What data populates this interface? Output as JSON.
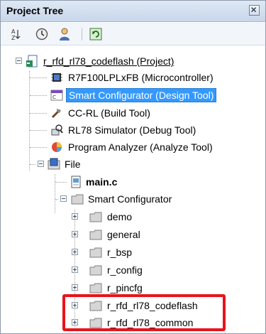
{
  "panel": {
    "title": "Project Tree"
  },
  "toolbar": {
    "buttons": [
      {
        "icon": "sort-az-icon"
      },
      {
        "icon": "clock-icon"
      },
      {
        "icon": "user-icon"
      },
      {
        "icon": "refresh-icon"
      }
    ]
  },
  "tree": {
    "project": "r_rfd_rl78_codeflash (Project)",
    "items": [
      {
        "label": "R7F100LPLxFB (Microcontroller)",
        "icon": "microcontroller-icon"
      },
      {
        "label": "Smart Configurator (Design Tool)",
        "icon": "smart-configurator-icon",
        "selected": true
      },
      {
        "label": "CC-RL (Build Tool)",
        "icon": "build-tool-icon"
      },
      {
        "label": "RL78 Simulator (Debug Tool)",
        "icon": "debug-tool-icon"
      },
      {
        "label": "Program Analyzer (Analyze Tool)",
        "icon": "analyze-tool-icon"
      }
    ],
    "file_node": "File",
    "main_file": "main.c",
    "sc_folder": "Smart Configurator",
    "folders": [
      "demo",
      "general",
      "r_bsp",
      "r_config",
      "r_pincfg",
      "r_rfd_rl78_codeflash",
      "r_rfd_rl78_common"
    ]
  },
  "colors": {
    "selection": "#3399ff",
    "highlight_box": "#e8141b",
    "title_bar": "#c7d6ea"
  }
}
